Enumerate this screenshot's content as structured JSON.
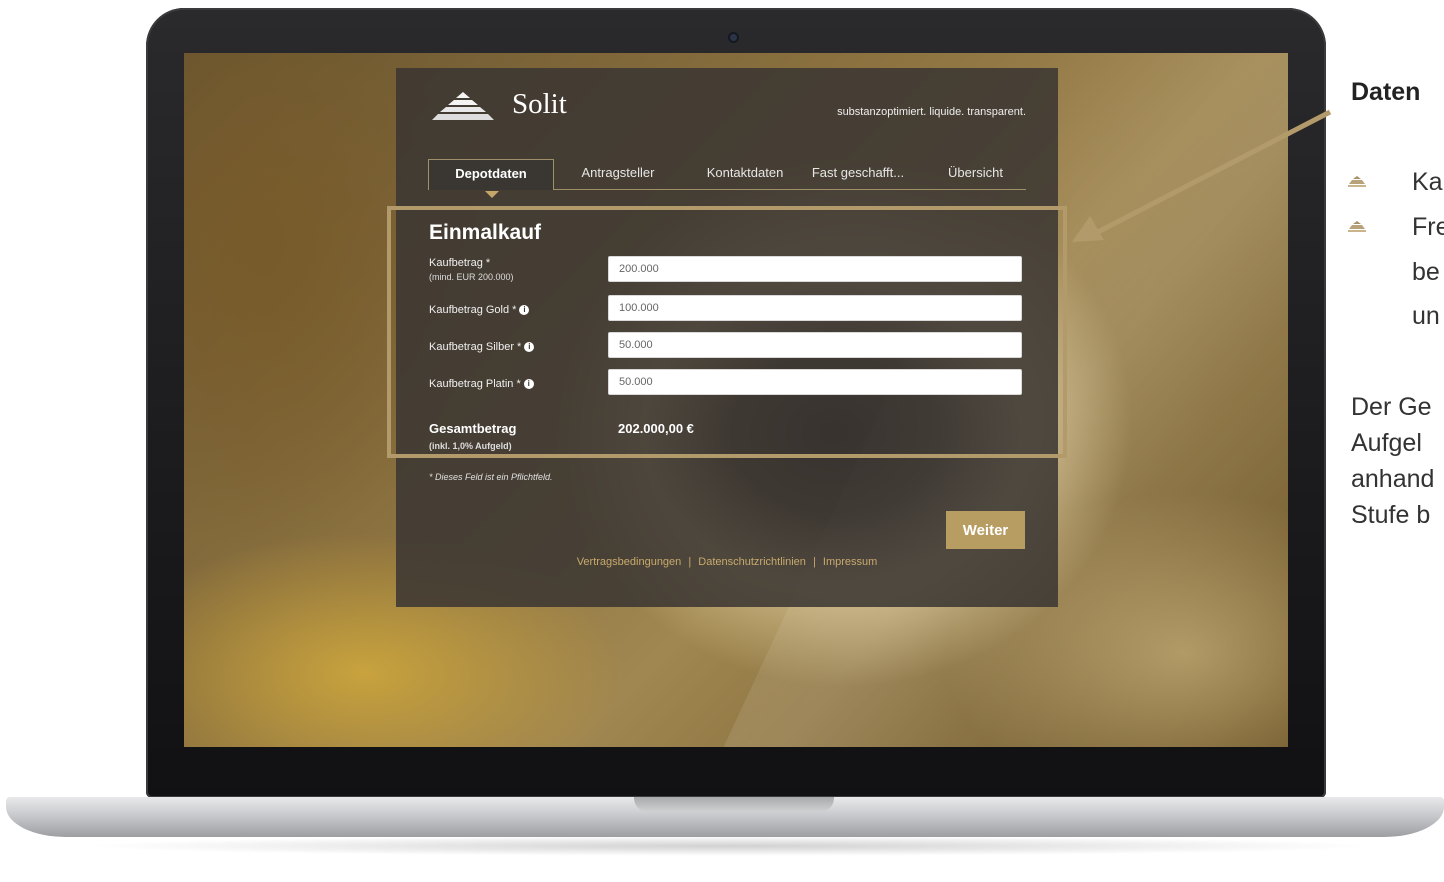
{
  "colors": {
    "accent": "#b89d63",
    "frame": "#b29a6a",
    "panel": "#3a3632"
  },
  "app": {
    "logo_text": "Solit",
    "tagline": "substanzoptimiert. liquide. transparent."
  },
  "tabs": [
    {
      "label": "Depotdaten",
      "active": true
    },
    {
      "label": "Antragsteller",
      "active": false
    },
    {
      "label": "Kontaktdaten",
      "active": false
    },
    {
      "label": "Fast geschafft...",
      "active": false
    },
    {
      "label": "Übersicht",
      "active": false
    }
  ],
  "form": {
    "title": "Einmalkauf",
    "fields": [
      {
        "label": "Kaufbetrag *",
        "sublabel": "(mind. EUR 200.000)",
        "value": "200.000"
      },
      {
        "label": "Kaufbetrag Gold *",
        "value": "100.000"
      },
      {
        "label": "Kaufbetrag Silber *",
        "value": "50.000"
      },
      {
        "label": "Kaufbetrag Platin *",
        "value": "50.000"
      }
    ],
    "total_label": "Gesamtbetrag",
    "total_sublabel": "(inkl. 1,0% Aufgeld)",
    "total_value": "202.000,00 €",
    "required_note": "* Dieses Feld ist ein Pflichtfeld.",
    "next_button": "Weiter"
  },
  "footer": {
    "links": [
      "Vertragsbedingungen",
      "Datenschutzrichtlinien",
      "Impressum"
    ],
    "separator": "|"
  },
  "side_text": {
    "heading": "Daten",
    "bullets": [
      [
        "Ka"
      ],
      [
        "Fre",
        "be",
        "un"
      ]
    ],
    "paragraph": [
      "Der Ge",
      "Aufgel",
      "anhand",
      "Stufe b"
    ]
  },
  "icons": {
    "logo": "pyramid-logo-icon",
    "info": "info-icon",
    "bullet": "pyramid-bullet-icon",
    "arrow": "callout-arrow-icon"
  }
}
